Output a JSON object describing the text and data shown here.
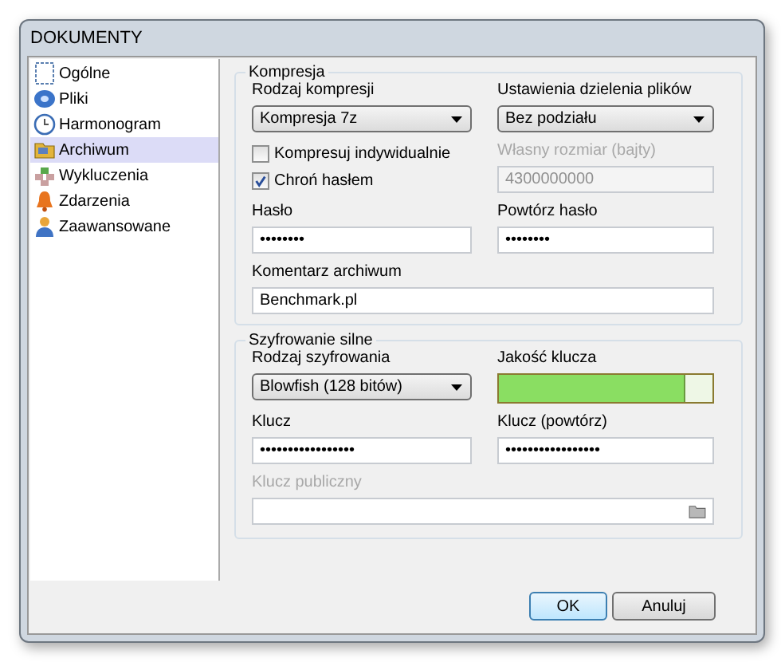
{
  "window": {
    "title": "DOKUMENTY"
  },
  "sidebar": {
    "items": [
      {
        "label": "Ogólne",
        "selected": false
      },
      {
        "label": "Pliki",
        "selected": false
      },
      {
        "label": "Harmonogram",
        "selected": false
      },
      {
        "label": "Archiwum",
        "selected": true
      },
      {
        "label": "Wykluczenia",
        "selected": false
      },
      {
        "label": "Zdarzenia",
        "selected": false
      },
      {
        "label": "Zaawansowane",
        "selected": false
      }
    ]
  },
  "compression": {
    "title": "Kompresja",
    "type": {
      "label": "Rodzaj kompresji",
      "value": "Kompresja 7z"
    },
    "split": {
      "label": "Ustawienia dzielenia plików",
      "value": "Bez podziału"
    },
    "individually": {
      "label": "Kompresuj indywidualnie",
      "checked": false
    },
    "protect": {
      "label": "Chroń hasłem",
      "checked": true
    },
    "custom_size": {
      "label": "Własny rozmiar (bajty)",
      "value": "4300000000",
      "disabled": true
    },
    "password": {
      "label": "Hasło",
      "value": "••••••••"
    },
    "password_repeat": {
      "label": "Powtórz hasło",
      "value": "••••••••"
    },
    "comment": {
      "label": "Komentarz archiwum",
      "value": "Benchmark.pl"
    }
  },
  "encryption": {
    "title": "Szyfrowanie silne",
    "type": {
      "label": "Rodzaj szyfrowania",
      "value": "Blowfish (128 bitów)"
    },
    "quality": {
      "label": "Jakość klucza",
      "level": 0.87
    },
    "key": {
      "label": "Klucz",
      "value": "•••••••••••••••••"
    },
    "key_repeat": {
      "label": "Klucz (powtórz)",
      "value": "•••••••••••••••••"
    },
    "public_key": {
      "label": "Klucz publiczny",
      "disabled": true
    }
  },
  "buttons": [
    {
      "label": "OK",
      "default": true
    },
    {
      "label": "Anuluj",
      "default": false
    }
  ]
}
